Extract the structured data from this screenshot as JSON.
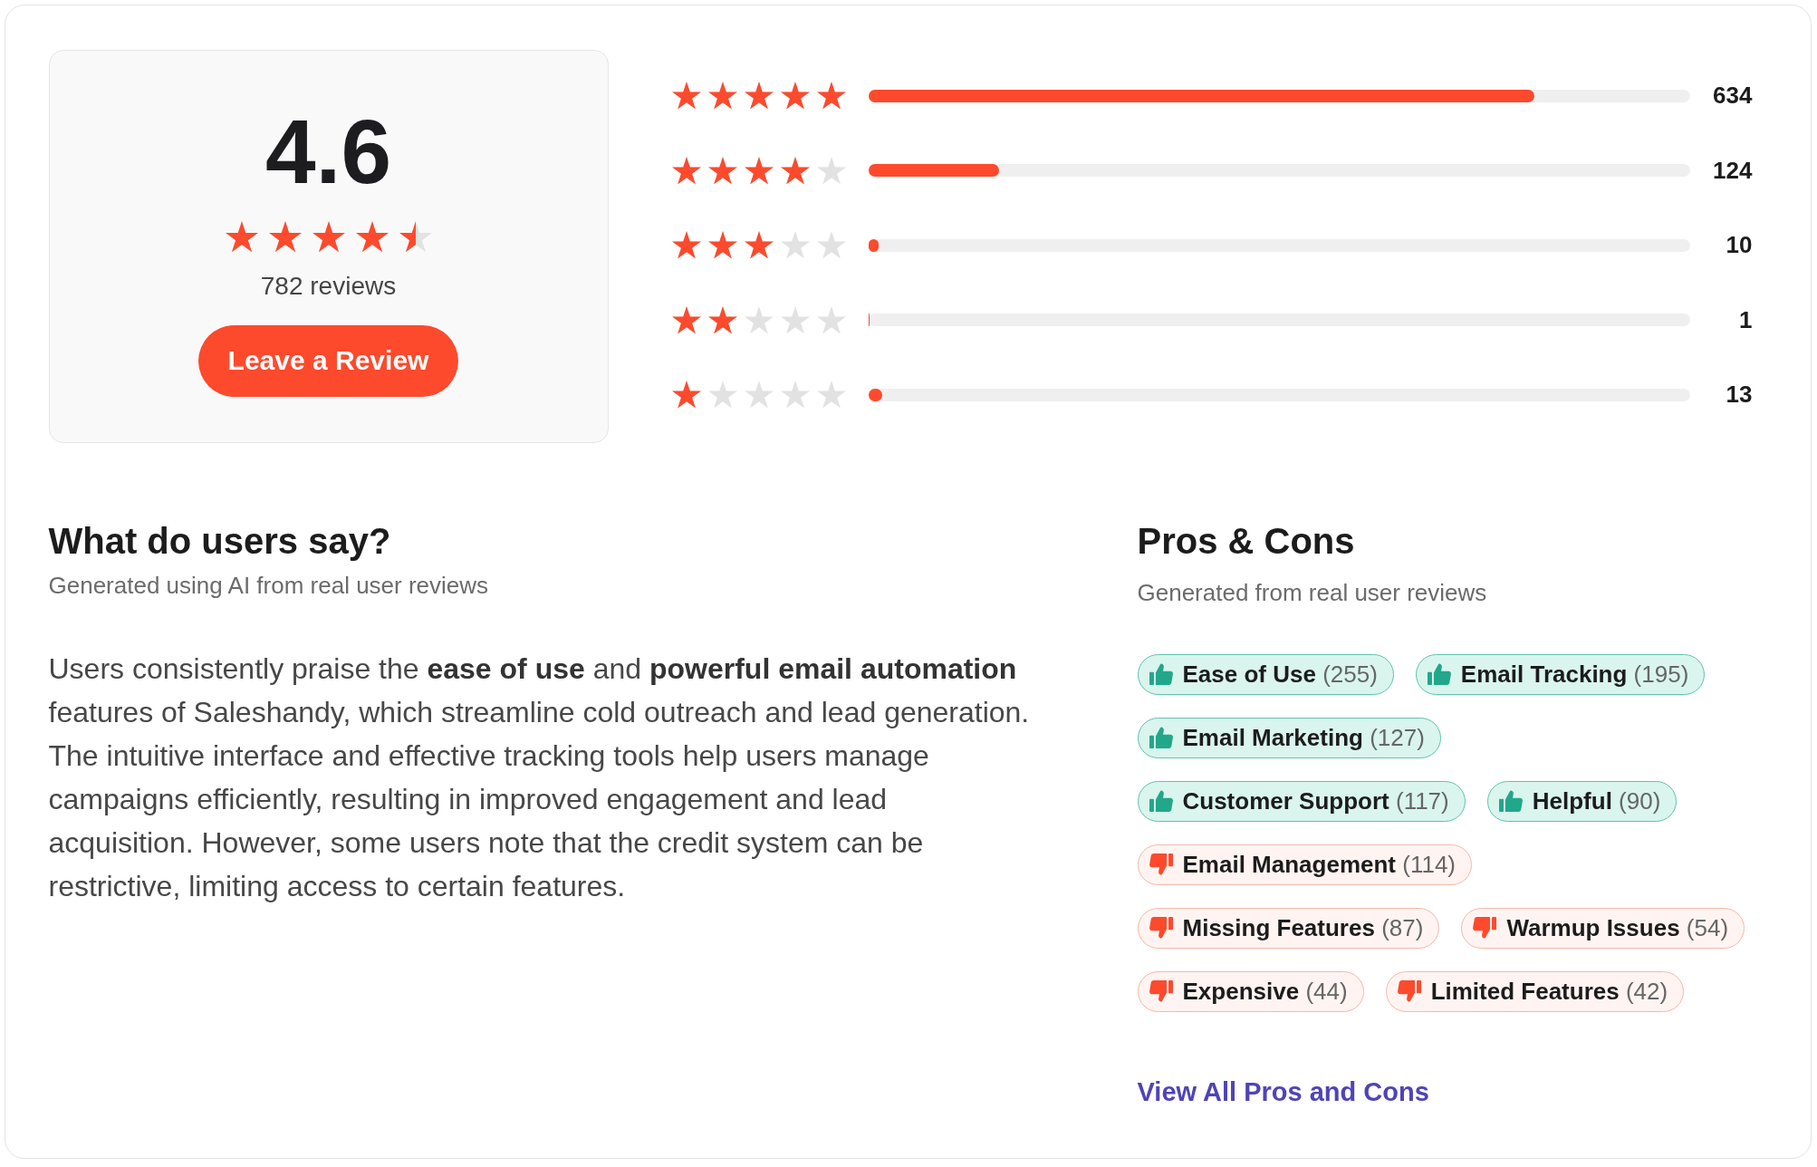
{
  "rating_summary": {
    "score": "4.6",
    "stars": 4.5,
    "reviews": "782 reviews",
    "button": "Leave a Review"
  },
  "distribution": [
    {
      "stars": 5,
      "level": 0.811,
      "count": "634"
    },
    {
      "stars": 4,
      "level": 0.159,
      "count": "124"
    },
    {
      "stars": 3,
      "level": 0.013,
      "count": "10"
    },
    {
      "stars": 2,
      "level": 0.0013,
      "count": "1"
    },
    {
      "stars": 1,
      "level": 0.017,
      "count": "13"
    }
  ],
  "summary": {
    "title": "What do users say?",
    "subtitle": "Generated using AI from real user reviews",
    "text": "Users consistently praise the **ease of use** and **powerful email automation** features of Saleshandy, which streamline cold outreach and lead generation. The intuitive interface and effective tracking tools help users manage campaigns efficiently, resulting in improved engagement and lead acquisition. However, some users note that the credit system can be restrictive, limiting access to certain features."
  },
  "pros_cons": {
    "title": "Pros & Cons",
    "subtitle": "Generated from real user reviews",
    "tags": [
      {
        "kind": "pro",
        "label": "Ease of Use",
        "count": "(255)"
      },
      {
        "kind": "pro",
        "label": "Email Tracking",
        "count": "(195)"
      },
      {
        "kind": "pro",
        "label": "Email Marketing",
        "count": "(127)"
      },
      {
        "kind": "pro",
        "label": "Customer Support",
        "count": "(117)"
      },
      {
        "kind": "pro",
        "label": "Helpful",
        "count": "(90)"
      },
      {
        "kind": "con",
        "label": "Email Management",
        "count": "(114)"
      },
      {
        "kind": "con",
        "label": "Missing Features",
        "count": "(87)"
      },
      {
        "kind": "con",
        "label": "Warmup Issues",
        "count": "(54)"
      },
      {
        "kind": "con",
        "label": "Expensive",
        "count": "(44)"
      },
      {
        "kind": "con",
        "label": "Limited Features",
        "count": "(42)"
      }
    ],
    "link": "View All Pros and Cons"
  }
}
